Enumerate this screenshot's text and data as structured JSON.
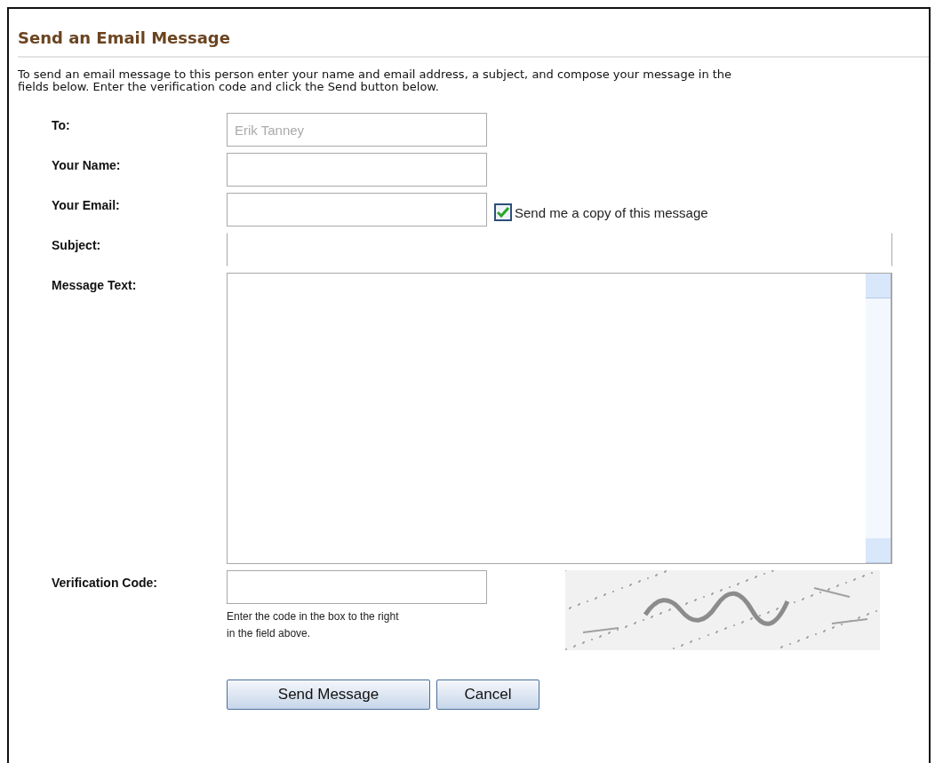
{
  "title": "Send an Email Message",
  "intro": "To send an email message to this person enter your name and email address, a subject, and compose your message in the fields below. Enter the verification code and click the Send button below.",
  "fields": [
    {
      "label": "To:",
      "kind": "short",
      "value": "Erik Tanney",
      "disabled": true
    },
    {
      "label": "Your Name:",
      "kind": "short"
    },
    {
      "label": "Your Email:",
      "kind": "short",
      "option": {
        "label": "Send me a copy of this message",
        "checked": true
      }
    },
    {
      "label": "Subject:",
      "kind": "wide"
    },
    {
      "label": "Message Text:",
      "kind": "area"
    },
    {
      "label": "Verification Code:",
      "kind": "captcha",
      "hint": "Enter the code in the box to the right in the field above."
    }
  ],
  "buttons": [
    {
      "label": "Send Message",
      "kind": "primary"
    },
    {
      "label": "Cancel",
      "kind": "secondary"
    }
  ]
}
